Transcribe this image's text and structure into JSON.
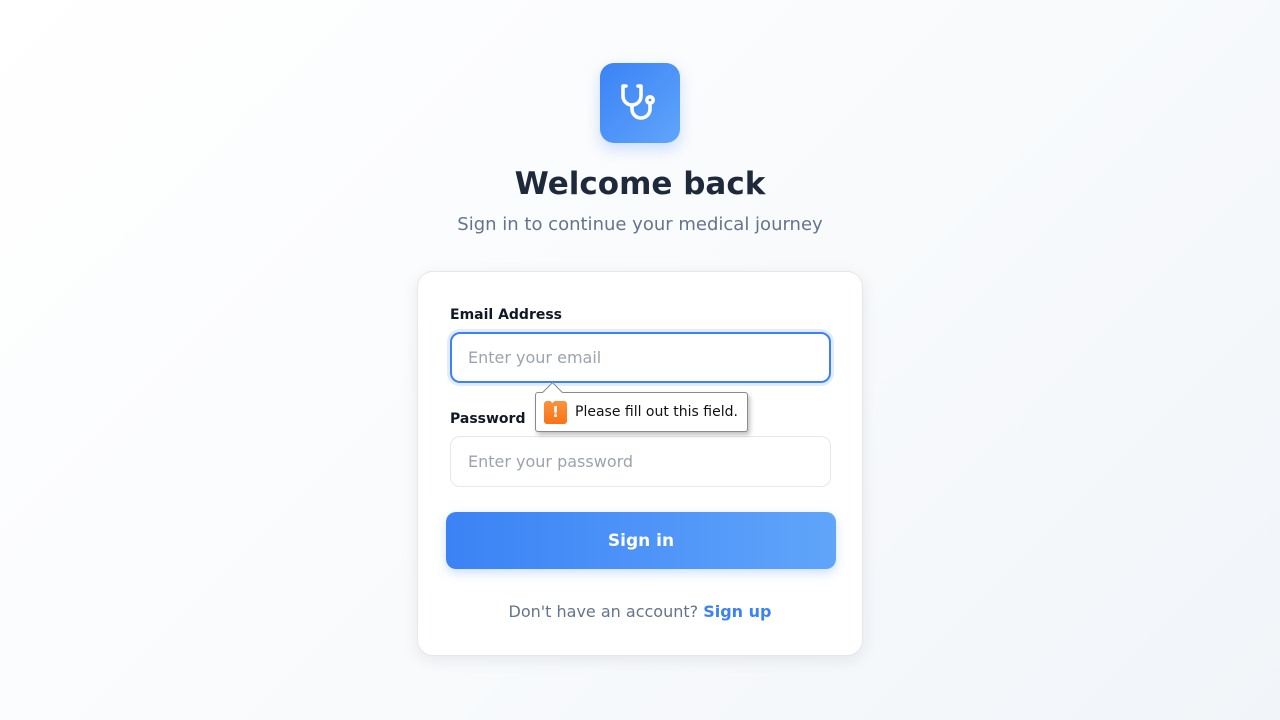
{
  "header": {
    "logo_icon": "stethoscope-icon",
    "title": "Welcome back",
    "subtitle": "Sign in to continue your medical journey"
  },
  "form": {
    "email": {
      "label": "Email Address",
      "placeholder": "Enter your email",
      "value": ""
    },
    "password": {
      "label": "Password",
      "placeholder": "Enter your password",
      "value": ""
    },
    "validation_tooltip": {
      "icon": "warning-icon",
      "message": "Please fill out this field."
    },
    "submit_label": "Sign in",
    "signup_prompt": "Don't have an account?",
    "signup_link": "Sign up"
  },
  "colors": {
    "accent": "#3b82f6",
    "title": "#1e293b",
    "muted": "#64748b",
    "warning": "#f97316"
  }
}
